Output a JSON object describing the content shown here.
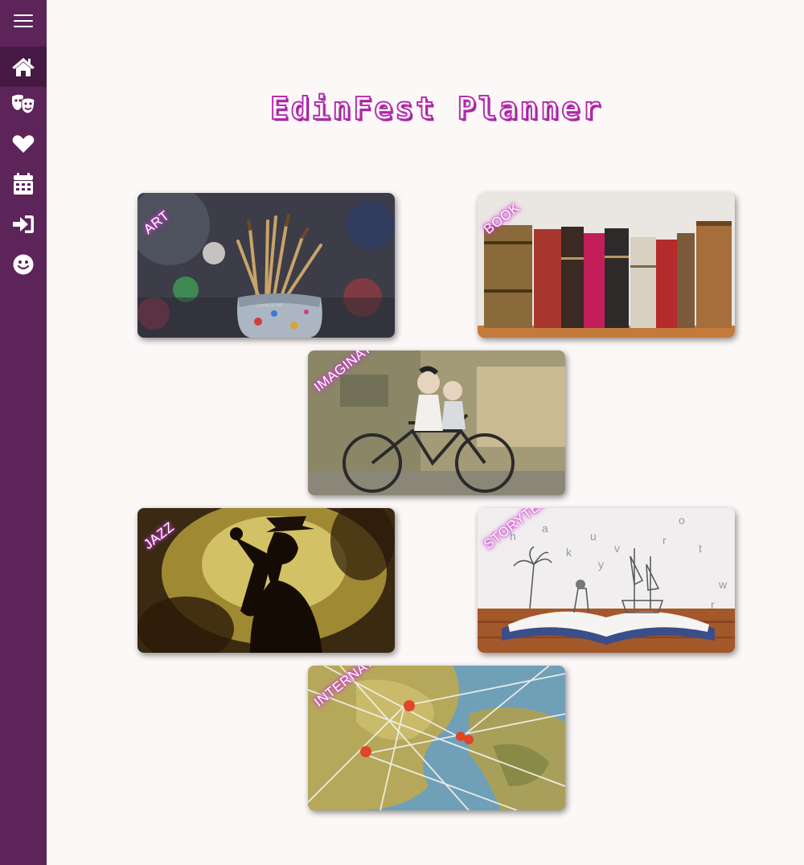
{
  "app": {
    "title": "EdinFest Planner"
  },
  "sidebar": {
    "items": [
      {
        "icon": "menu-icon"
      },
      {
        "icon": "home-icon",
        "active": true
      },
      {
        "icon": "theater-masks-icon"
      },
      {
        "icon": "heart-icon"
      },
      {
        "icon": "calendar-icon"
      },
      {
        "icon": "sign-in-icon"
      },
      {
        "icon": "smile-icon"
      }
    ]
  },
  "categories": [
    {
      "label": "ART"
    },
    {
      "label": "BOOK"
    },
    {
      "label": "IMAGINATE"
    },
    {
      "label": "JAZZ"
    },
    {
      "label": "STORYTELLING"
    },
    {
      "label": "INTERNATIONAL"
    }
  ],
  "colors": {
    "sidebar_bg": "#5c2459",
    "sidebar_active": "#451943",
    "page_bg": "#fdf8f8",
    "title_accent": "#b72fb0",
    "label_glow": "#d23fd4"
  }
}
